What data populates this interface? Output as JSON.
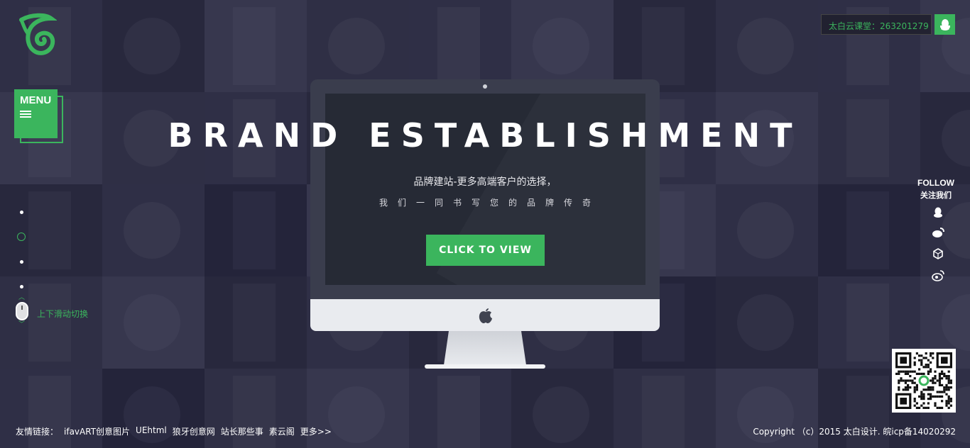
{
  "brand": {
    "logo": "leaf-swirl-logo",
    "accent_color": "#3bb55d"
  },
  "menu": {
    "label": "MENU",
    "icon": "list-icon"
  },
  "contact": {
    "text": "太白云课堂：263201279",
    "icon": "qq-penguin-icon"
  },
  "hero": {
    "headline": "BRAND ESTABLISHMENT",
    "subtitle": "品牌建站-更多高端客户的选择，",
    "tagline": "我们一同书写您的品牌传奇",
    "cta_label": "click to view"
  },
  "scroll_hint": {
    "text": "上下滑动切换",
    "icon": "mouse-icon"
  },
  "follow": {
    "title_en": "FOLLOW",
    "title_cn": "关注我们",
    "icons": [
      "qq-icon",
      "weibo-tencent-icon",
      "cube-icon",
      "weibo-icon"
    ]
  },
  "footer": {
    "links_label": "友情链接：",
    "links": [
      "ifavART创意图片",
      "UEhtml",
      "狼牙创意网",
      "站长那些事",
      "素云阁",
      "更多>>"
    ],
    "copyright": "Copyright （c）2015 太白设计. 皖icp备14020292"
  }
}
